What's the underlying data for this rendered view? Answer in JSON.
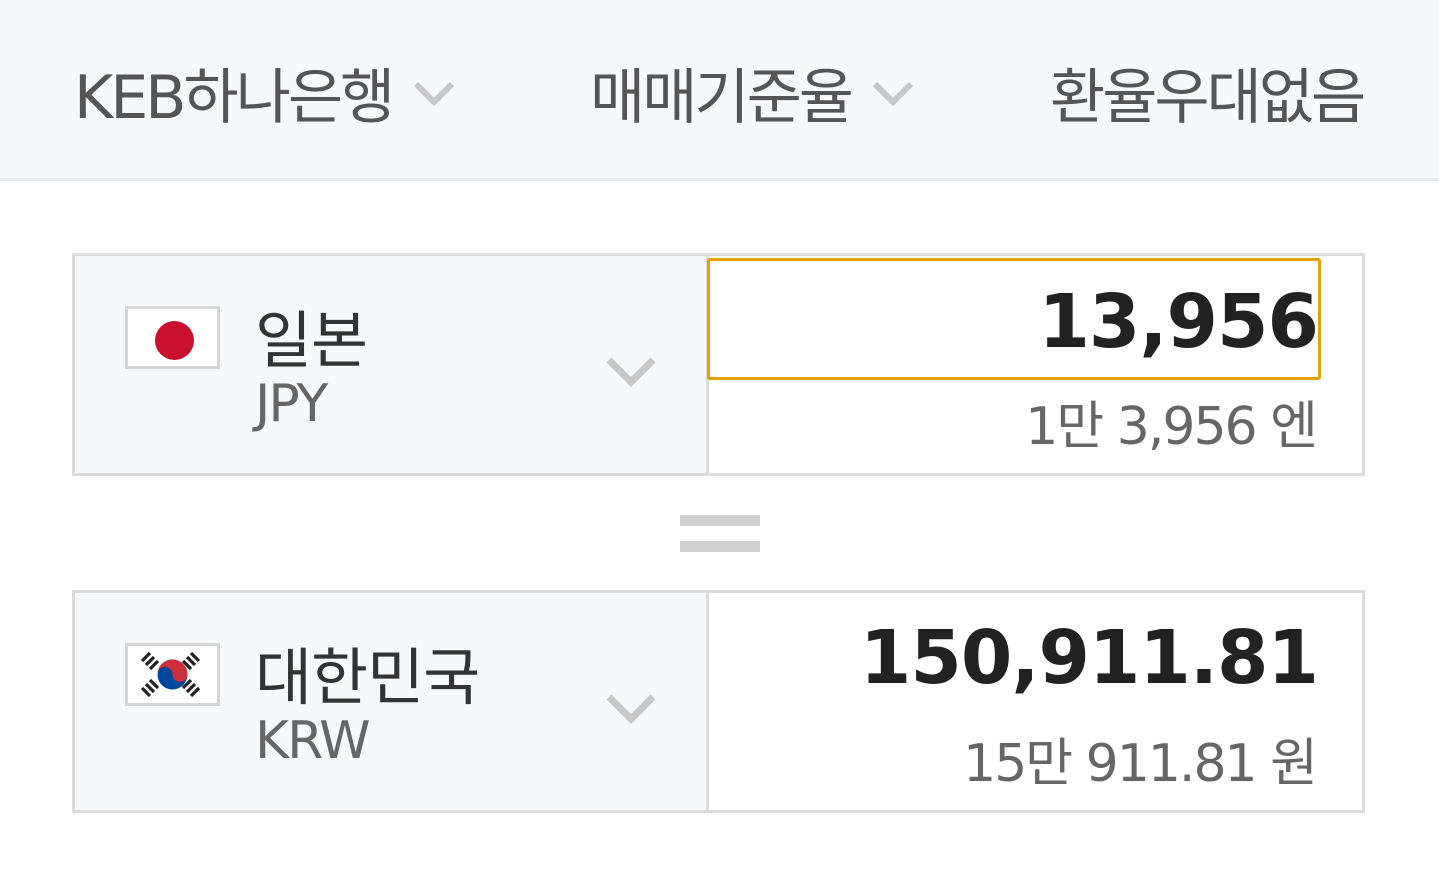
{
  "filters": {
    "bank": "KEB하나은행",
    "rate_type": "매매기준율",
    "discount": "환율우대없음"
  },
  "from": {
    "country": "일본",
    "code": "JPY",
    "amount": "13,956",
    "amount_korean": "1만 3,956 엔",
    "flag_color": "#c8102e"
  },
  "to": {
    "country": "대한민국",
    "code": "KRW",
    "amount": "150,911.81",
    "amount_korean": "15만 911.81 원"
  },
  "colors": {
    "focus_border": "#e6a100",
    "chevron": "#c8c8c8"
  }
}
